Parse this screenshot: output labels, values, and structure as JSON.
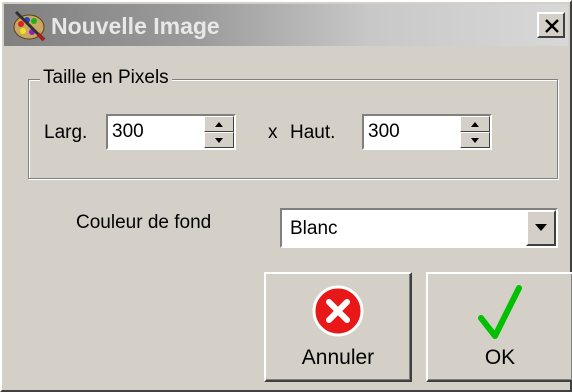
{
  "window": {
    "title": "Nouvelle Image",
    "close_glyph": "×"
  },
  "group": {
    "label": "Taille en Pixels",
    "width_label": "Larg.",
    "width_value": "300",
    "separator": "x",
    "height_label": "Haut.",
    "height_value": "300"
  },
  "background": {
    "label": "Couleur de fond",
    "selected": "Blanc"
  },
  "buttons": {
    "cancel_label": "Annuler",
    "ok_label": "OK"
  },
  "colors": {
    "cancel_icon": "#e81818",
    "ok_icon": "#00c000"
  },
  "icons": {
    "app": "palette-brush-icon",
    "cancel": "red-x-circle-icon",
    "ok": "green-checkmark-icon",
    "close": "close-icon"
  }
}
